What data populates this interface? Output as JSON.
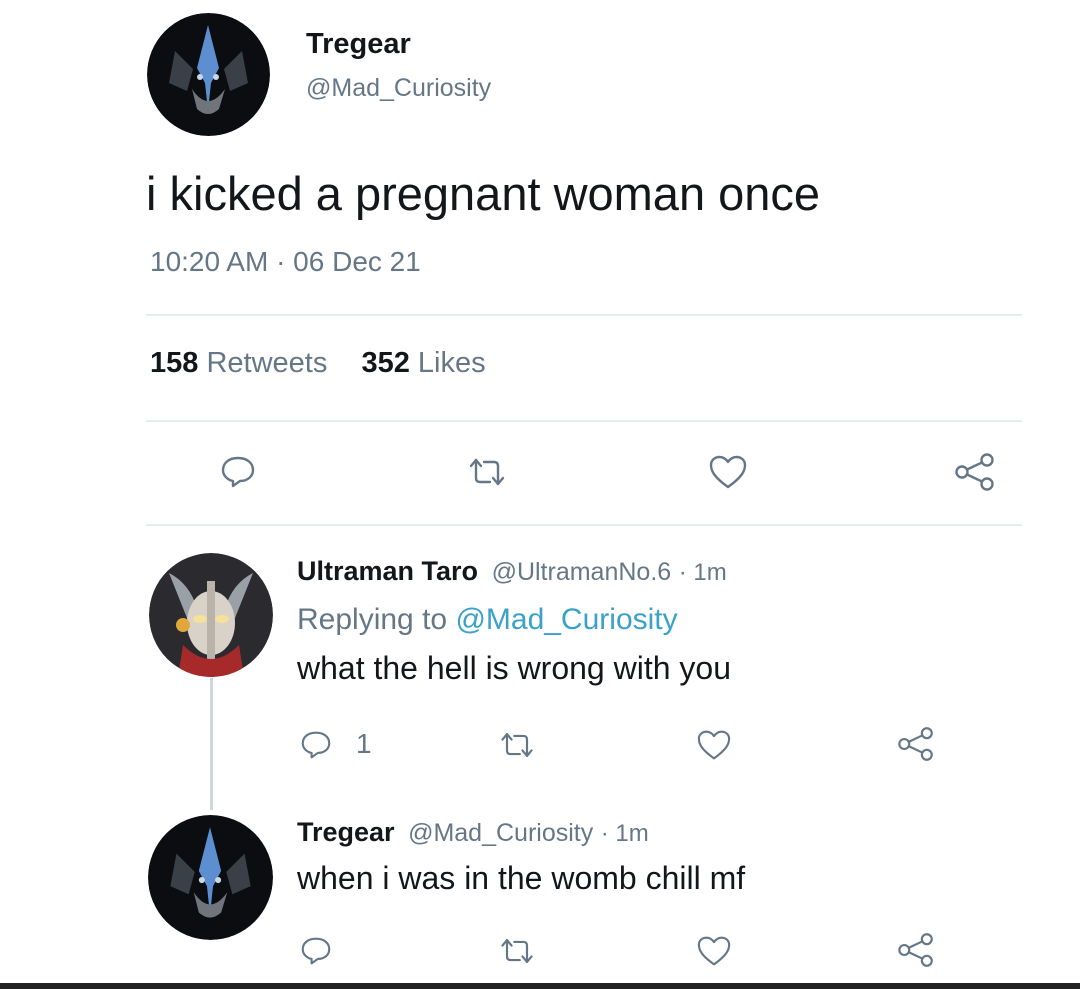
{
  "main_tweet": {
    "author_name": "Tregear",
    "author_handle": "@Mad_Curiosity",
    "text": "i kicked a pregnant woman once",
    "timestamp": "10:20 AM · 06 Dec 21",
    "retweets_count": "158",
    "retweets_label": "Retweets",
    "likes_count": "352",
    "likes_label": "Likes"
  },
  "reply_1": {
    "author_name": "Ultraman Taro",
    "author_handle": "@UltramanNo.6",
    "age": "· 1m",
    "replying_prefix": "Replying to",
    "replying_handle": "@Mad_Curiosity",
    "text": "what the hell is wrong with you",
    "reply_count": "1"
  },
  "reply_2": {
    "author_name": "Tregear",
    "author_handle": "@Mad_Curiosity",
    "age": "· 1m",
    "text": "when i was in the womb chill mf"
  },
  "icons": {
    "reply": "reply-icon",
    "retweet": "retweet-icon",
    "like": "heart-icon",
    "share": "share-icon"
  },
  "colors": {
    "link": "#1da1f2",
    "secondary_text": "#657786",
    "divider": "#e8ecef"
  }
}
